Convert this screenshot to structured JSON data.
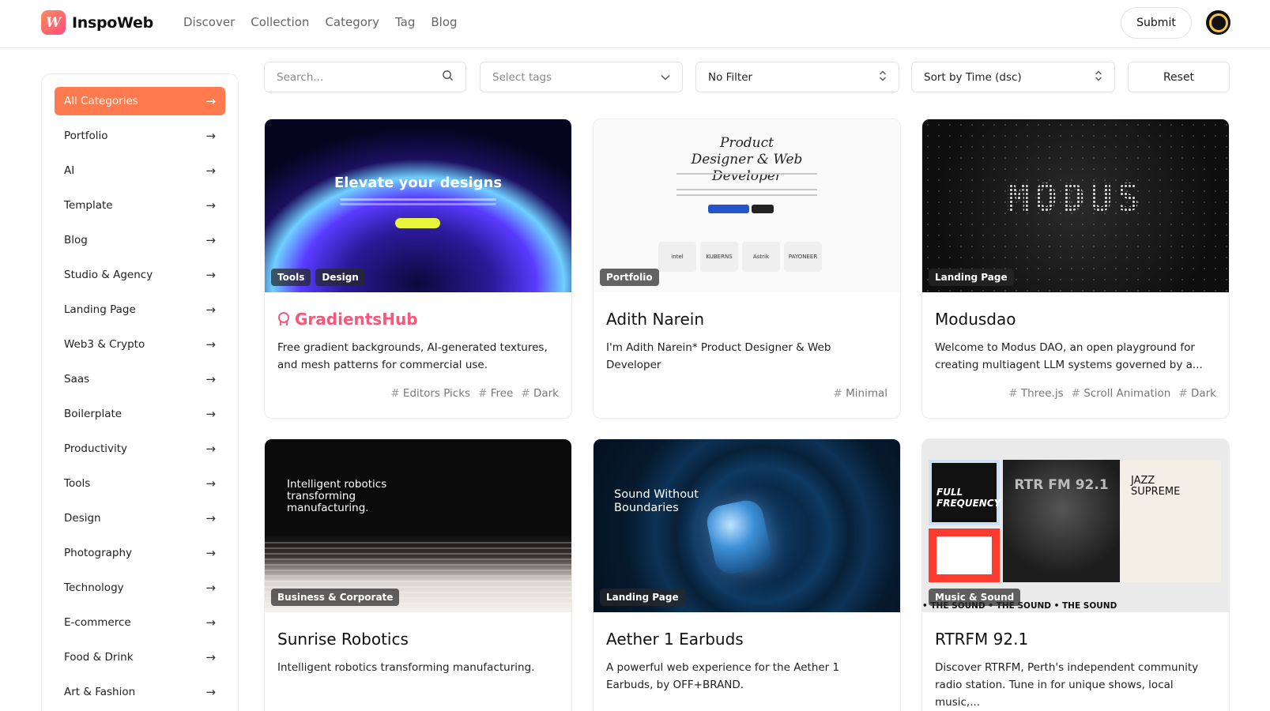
{
  "brand": {
    "name": "InspoWeb",
    "logo_letter": "W"
  },
  "nav": [
    "Discover",
    "Collection",
    "Category",
    "Tag",
    "Blog"
  ],
  "header": {
    "submit_label": "Submit"
  },
  "filters": {
    "search_placeholder": "Search...",
    "tags_placeholder": "Select tags",
    "filter_value": "No Filter",
    "sort_value": "Sort by Time (dsc)",
    "reset_label": "Reset"
  },
  "categories": [
    "All Categories",
    "Portfolio",
    "AI",
    "Template",
    "Blog",
    "Studio & Agency",
    "Landing Page",
    "Web3 & Crypto",
    "Saas",
    "Boilerplate",
    "Productivity",
    "Tools",
    "Design",
    "Photography",
    "Technology",
    "E-commerce",
    "Food & Drink",
    "Art & Fashion"
  ],
  "active_category": "All Categories",
  "cards": [
    {
      "title": "GradientsHub",
      "featured": true,
      "badges": [
        "Tools",
        "Design"
      ],
      "description": "Free gradient backgrounds, AI-generated textures, and mesh patterns for commercial use.",
      "tags": [
        "Editors Picks",
        "Free",
        "Dark"
      ],
      "thumb_text": "Elevate your designs"
    },
    {
      "title": "Adith Narein",
      "featured": false,
      "badges": [
        "Portfolio"
      ],
      "description": "I'm Adith Narein* Product Designer & Web Developer",
      "tags": [
        "Minimal"
      ],
      "thumb_text": "Product Designer & Web Developer",
      "thumb_logos": [
        "intel",
        "KUBERNS",
        "Astrik",
        "PAYONEER"
      ]
    },
    {
      "title": "Modusdao",
      "featured": false,
      "badges": [
        "Landing Page"
      ],
      "description": "Welcome to Modus DAO, an open playground for creating multiagent LLM systems governed by a...",
      "tags": [
        "Three.js",
        "Scroll Animation",
        "Dark"
      ],
      "thumb_text": "MODUS"
    },
    {
      "title": "Sunrise Robotics",
      "featured": false,
      "badges": [
        "Business & Corporate"
      ],
      "description": "Intelligent robotics transforming manufacturing.",
      "tags": [],
      "thumb_text": "Intelligent robotics transforming manufacturing."
    },
    {
      "title": "Aether 1 Earbuds",
      "featured": false,
      "badges": [
        "Landing Page"
      ],
      "description": "A powerful web experience for the Aether 1 Earbuds, by OFF+BRAND.",
      "tags": [],
      "thumb_text": "Sound Without Boundaries"
    },
    {
      "title": "RTRFM 92.1",
      "featured": false,
      "badges": [
        "Music & Sound"
      ],
      "description": "Discover RTRFM, Perth's independent community radio station. Tune in for unique shows, local music,...",
      "tags": [],
      "thumb_texts": [
        "FULL FREQUENCY",
        "RTR FM 92.1",
        "JAZZ SUPREME",
        "• THE SOUND • THE SOUND • THE SOUND"
      ]
    }
  ],
  "colors": {
    "accent": "#ff7b4f",
    "featured": "#f4587a"
  },
  "icons": [
    "search-icon",
    "chevron-down-icon",
    "updown-chevron-icon",
    "arrow-right-icon",
    "ribbon-icon"
  ]
}
